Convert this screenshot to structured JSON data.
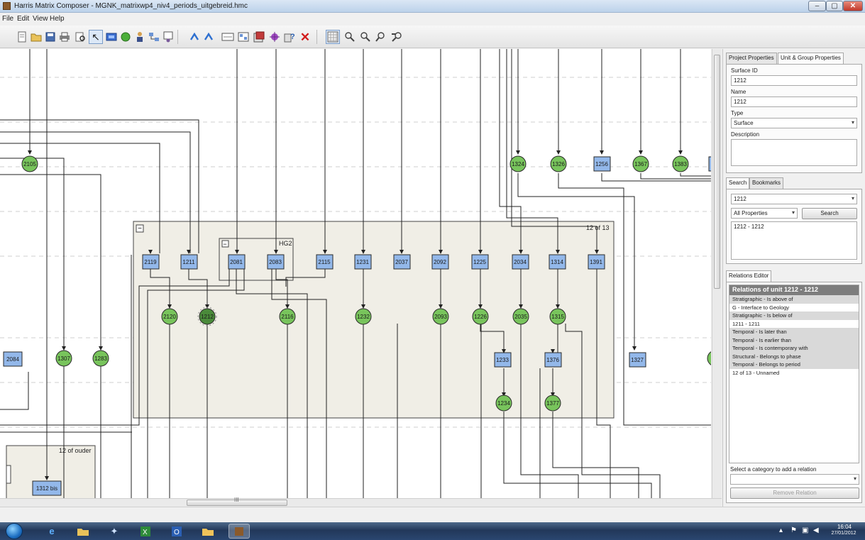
{
  "window": {
    "title": "Harris Matrix Composer - MGNK_matrixwp4_niv4_periods_uitgebreid.hmc",
    "minimize": "–",
    "maximize": "▢",
    "close": "✕"
  },
  "menu": [
    "File",
    "Edit",
    "View",
    "Help"
  ],
  "toolbar_icons": [
    "new-file-icon",
    "open-folder-icon",
    "save-icon",
    "print-icon",
    "print-preview-icon",
    "pointer-icon",
    "add-unit-icon",
    "add-surface-icon",
    "add-user-icon",
    "layout-icon",
    "group-icon",
    "undo-icon",
    "redo-icon",
    "add-group-icon",
    "add-phase-icon",
    "export-icon",
    "validate-icon",
    "help-icon",
    "delete-icon",
    "grid-icon",
    "zoom-in-icon",
    "zoom-out-icon",
    "zoom-fit-icon",
    "zoom-reset-icon"
  ],
  "colors": {
    "unit_fill": "#93b8ea",
    "surface_fill": "#78c45c",
    "surface_selected": "#4a8a3a",
    "group_fill": "#f0eee6"
  },
  "matrix": {
    "groups": {
      "main_group_label": "12 of 13",
      "hg2_label": "HG2",
      "lower_group_label": "12 of ouder",
      "collapse_symbol": "−"
    },
    "units": [
      "2119",
      "1211",
      "2081",
      "2083",
      "2115",
      "1231",
      "2037",
      "2092",
      "1225",
      "2034",
      "1314",
      "1391",
      "1256",
      "2084",
      "1233",
      "1376",
      "1327",
      "1312 bis"
    ],
    "surfaces": [
      "2105",
      "1324",
      "1326",
      "1367",
      "1383",
      "2120",
      "1212",
      "2116",
      "1232",
      "2093",
      "1226",
      "2035",
      "1315",
      "1307",
      "1283",
      "1234",
      "1377"
    ],
    "selected": "1212"
  },
  "scrollbar": {
    "grip": "III"
  },
  "properties": {
    "tabs": [
      "Project Properties",
      "Unit & Group Properties"
    ],
    "surface_id_label": "Surface ID",
    "surface_id": "1212",
    "name_label": "Name",
    "name": "1212",
    "type_label": "Type",
    "type": "Surface",
    "description_label": "Description",
    "description": ""
  },
  "search": {
    "tabs": [
      "Search",
      "Bookmarks"
    ],
    "query": "1212",
    "scope": "All Properties",
    "button": "Search",
    "results": [
      "1212 - 1212"
    ]
  },
  "relations": {
    "tab": "Relations Editor",
    "title": "Relations of unit 1212 - 1212",
    "rows": [
      {
        "text": "Stratigraphic - Is above of",
        "cat": true
      },
      {
        "text": "G - Interface to Geology",
        "cat": false
      },
      {
        "text": "Stratigraphic - Is below of",
        "cat": true
      },
      {
        "text": "1211 - 1211",
        "cat": false
      },
      {
        "text": "Temporal - Is later than",
        "cat": true
      },
      {
        "text": "Temporal - Is earlier than",
        "cat": true
      },
      {
        "text": "Temporal - Is contemporary with",
        "cat": true
      },
      {
        "text": "Structural - Belongs to phase",
        "cat": true
      },
      {
        "text": "Temporal - Belongs to period",
        "cat": true
      },
      {
        "text": "12 of 13 - Unnamed",
        "cat": false
      }
    ],
    "add_hint": "Select a category to add a relation",
    "add_value": "",
    "remove_button": "Remove Relation"
  },
  "taskbar": {
    "time": "16:04",
    "date": "27/01/2012"
  }
}
